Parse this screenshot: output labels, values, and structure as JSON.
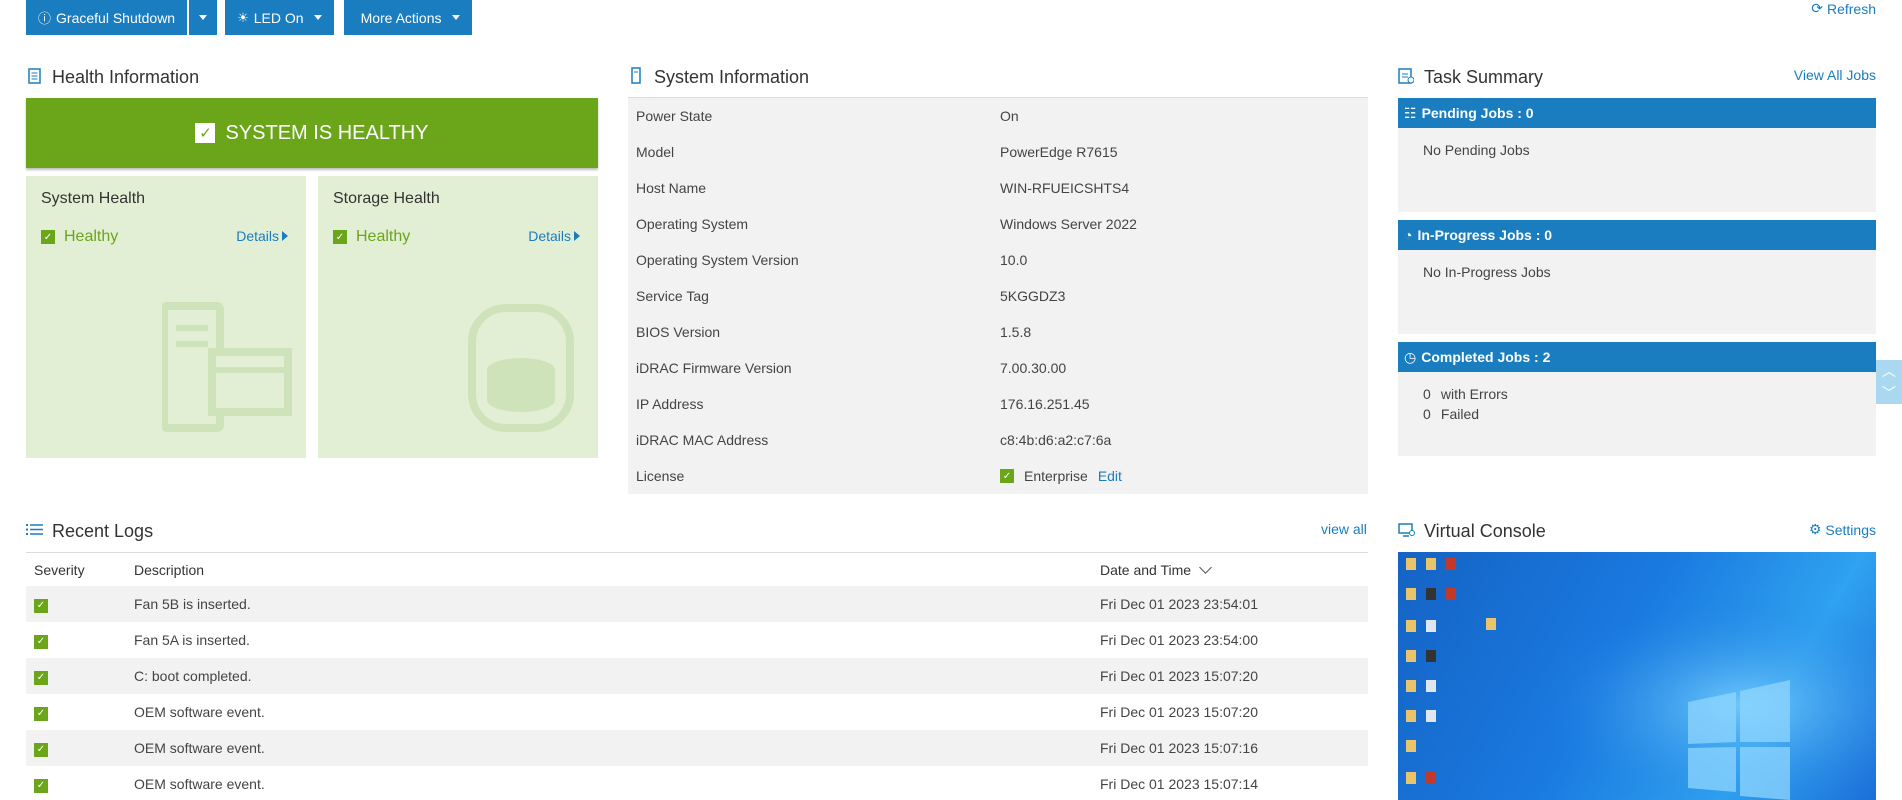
{
  "toolbar": {
    "graceful_shutdown": "Graceful Shutdown",
    "led_on": "LED On",
    "more_actions": "More Actions",
    "refresh": "Refresh"
  },
  "health": {
    "title": "Health Information",
    "banner": "SYSTEM IS HEALTHY",
    "cards": [
      {
        "title": "System Health",
        "status": "Healthy",
        "details": "Details"
      },
      {
        "title": "Storage Health",
        "status": "Healthy",
        "details": "Details"
      }
    ]
  },
  "system": {
    "title": "System Information",
    "rows": [
      {
        "label": "Power State",
        "value": "On"
      },
      {
        "label": "Model",
        "value": "PowerEdge R7615"
      },
      {
        "label": "Host Name",
        "value": "WIN-RFUEICSHTS4"
      },
      {
        "label": "Operating System",
        "value": "Windows Server 2022"
      },
      {
        "label": "Operating System Version",
        "value": "10.0"
      },
      {
        "label": "Service Tag",
        "value": "5KGGDZ3"
      },
      {
        "label": "BIOS Version",
        "value": "1.5.8"
      },
      {
        "label": "iDRAC Firmware Version",
        "value": "7.00.30.00"
      },
      {
        "label": "IP Address",
        "value": "176.16.251.45"
      },
      {
        "label": "iDRAC MAC Address",
        "value": "c8:4b:d6:a2:c7:6a"
      }
    ],
    "license": {
      "label": "License",
      "value": "Enterprise",
      "edit": "Edit"
    }
  },
  "tasks": {
    "title": "Task Summary",
    "view_all": "View All Jobs",
    "pending": {
      "header": "Pending Jobs : 0",
      "text": "No Pending Jobs"
    },
    "inprogress": {
      "header": "In-Progress Jobs : 0",
      "text": "No In-Progress Jobs"
    },
    "completed": {
      "header": "Completed Jobs : 2",
      "errors_count": "0",
      "errors_label": "with Errors",
      "failed_count": "0",
      "failed_label": "Failed"
    }
  },
  "logs": {
    "title": "Recent Logs",
    "view_all": "view all",
    "columns": {
      "severity": "Severity",
      "description": "Description",
      "date": "Date and Time"
    },
    "rows": [
      {
        "description": "Fan 5B is inserted.",
        "date": "Fri Dec 01 2023 23:54:01"
      },
      {
        "description": "Fan 5A is inserted.",
        "date": "Fri Dec 01 2023 23:54:00"
      },
      {
        "description": "C: boot completed.",
        "date": "Fri Dec 01 2023 15:07:20"
      },
      {
        "description": "OEM software event.",
        "date": "Fri Dec 01 2023 15:07:20"
      },
      {
        "description": "OEM software event.",
        "date": "Fri Dec 01 2023 15:07:16"
      },
      {
        "description": "OEM software event.",
        "date": "Fri Dec 01 2023 15:07:14"
      }
    ]
  },
  "console": {
    "title": "Virtual Console",
    "settings": "Settings"
  },
  "colors": {
    "accent": "#1a7dbf",
    "healthy": "#6aa51a",
    "card_bg": "#e3efd5"
  }
}
